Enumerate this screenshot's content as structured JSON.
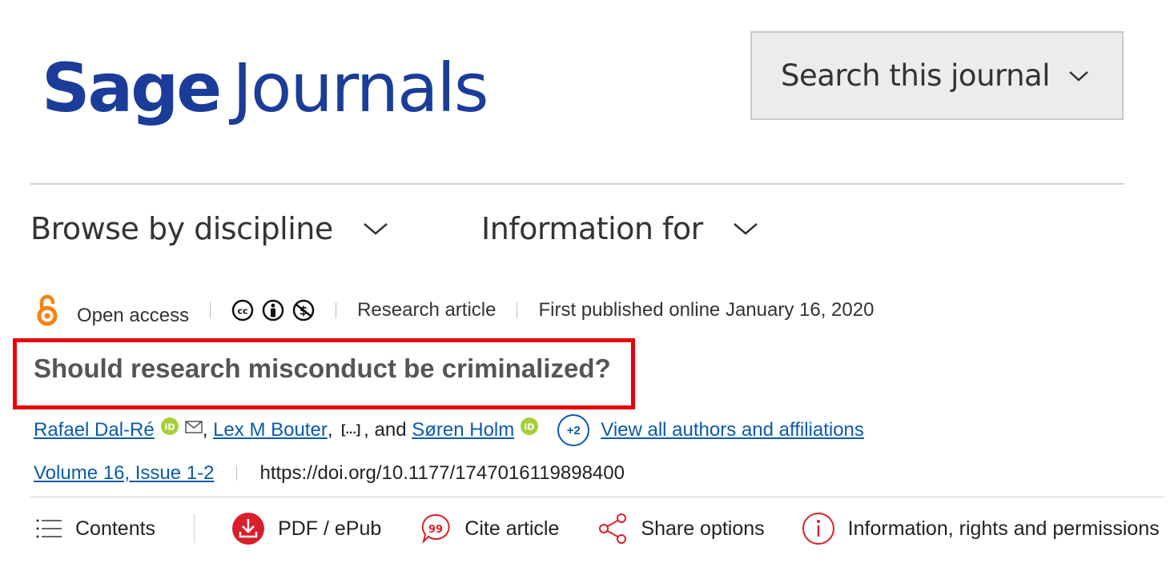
{
  "header": {
    "logo_word1": "Sage",
    "logo_word2": "Journals",
    "logo_color": "#1b3d99",
    "search_label": "Search this journal"
  },
  "nav": {
    "browse_label": "Browse by discipline",
    "info_label": "Information for"
  },
  "article": {
    "access_label": "Open access",
    "license_icons": [
      "cc-icon",
      "by-icon",
      "nc-icon"
    ],
    "type_label": "Research article",
    "published_label": "First published online January 16, 2020",
    "title": "Should research misconduct be criminalized?",
    "highlight_color": "#e8000a",
    "authors": {
      "author1": "Rafael Dal-Ré",
      "author2": "Lex M Bouter",
      "ellipsis": "[...]",
      "and_text": ", and",
      "author_last": "Søren Holm",
      "more_count": "+2",
      "view_all_label": "View all authors and affiliations"
    },
    "volume_label": "Volume 16, Issue 1-2",
    "doi": "https://doi.org/10.1177/1747016119898400"
  },
  "toolbar": {
    "contents_label": "Contents",
    "pdf_label": "PDF / ePub",
    "cite_label": "Cite article",
    "share_label": "Share options",
    "info_label": "Information, rights and permissions",
    "accent_color": "#d91f2b"
  }
}
